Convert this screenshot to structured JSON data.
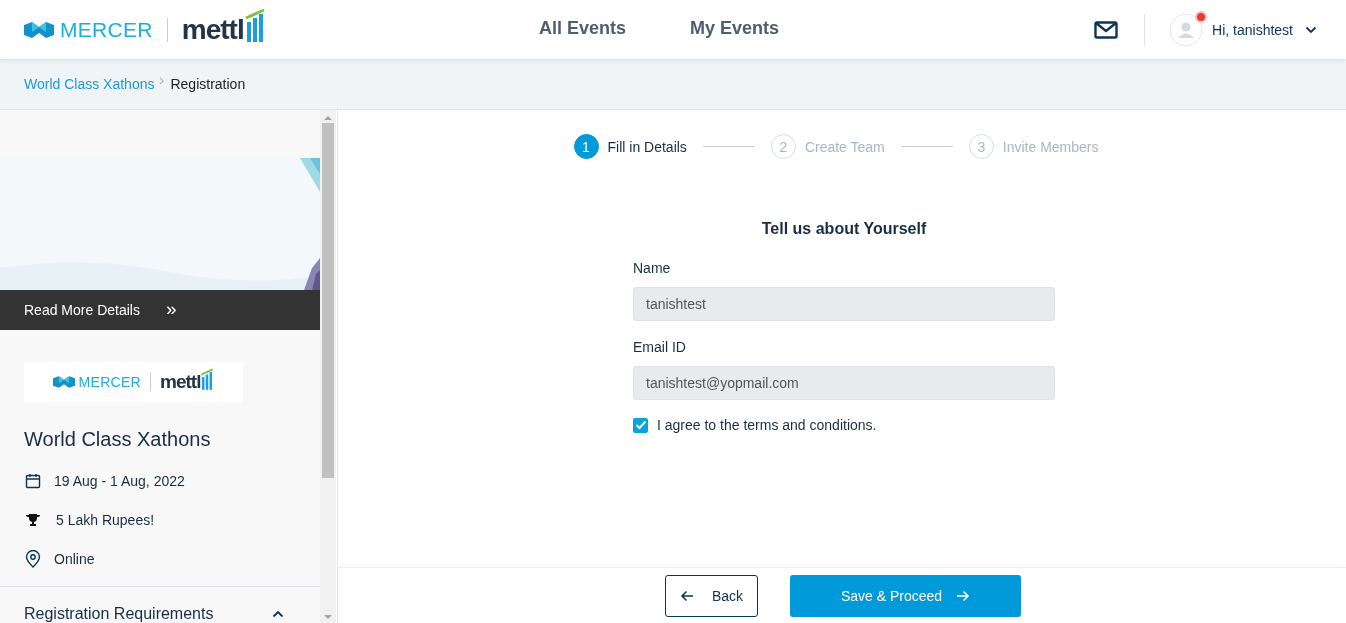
{
  "header": {
    "logo": {
      "brand": "MERCER",
      "product": "mettl"
    },
    "nav": [
      {
        "label": "All Events",
        "selected": false
      },
      {
        "label": "My Events",
        "selected": false
      }
    ],
    "notification": true,
    "greeting": "Hi, tanishtest"
  },
  "breadcrumb": [
    {
      "label": "World Class Xathons",
      "kind": "link"
    },
    {
      "label": "Registration",
      "kind": "current"
    }
  ],
  "sidebar": {
    "read_more": "Read More Details",
    "read_more_icon": "»",
    "logo": {
      "brand": "MERCER",
      "product": "mettl"
    },
    "title": "World Class Xathons",
    "facts": [
      {
        "kind": "date",
        "text": "19 Aug - 1 Aug, 2022"
      },
      {
        "kind": "prize",
        "text": "5 Lakh Rupees!"
      },
      {
        "kind": "location",
        "text": "Online"
      }
    ],
    "section": {
      "title": "Registration Requirements",
      "expanded": true
    }
  },
  "stepper": [
    {
      "number": "1",
      "label": "Fill in Details",
      "selected": true
    },
    {
      "number": "2",
      "label": "Create Team",
      "selected": false
    },
    {
      "number": "3",
      "label": "Invite Members",
      "selected": false
    }
  ],
  "form": {
    "heading": "Tell us about Yourself",
    "fields": [
      {
        "label": "Name",
        "value": "tanishtest",
        "disabled": true
      },
      {
        "label": "Email ID",
        "value": "tanishtest@yopmail.com",
        "disabled": true
      }
    ],
    "agree": {
      "label": "I agree to the terms and conditions.",
      "checked": true
    }
  },
  "footer": {
    "back": "Back",
    "proceed": "Save & Proceed"
  }
}
